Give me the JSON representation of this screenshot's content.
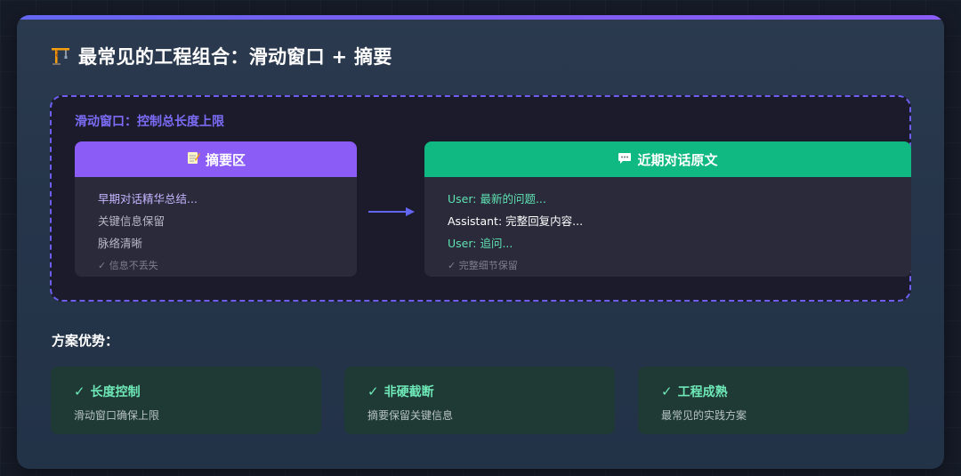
{
  "title": "最常见的工程组合：滑动窗口 + 摘要",
  "icons": {
    "title_icon": "building-construction-crane-icon",
    "summary_icon": "memo-icon",
    "recent_icon": "speech-bubble-icon",
    "arrow": "arrow-right-icon",
    "check": "check-mark-icon"
  },
  "window": {
    "label": "滑动窗口：控制总长度上限"
  },
  "summary_panel": {
    "title": "摘要区",
    "lines": [
      "早期对话精华总结...",
      "关键信息保留",
      "脉络清晰",
      "✓ 信息不丢失"
    ]
  },
  "recent_panel": {
    "title": "近期对话原文",
    "lines": [
      "User: 最新的问题...",
      "Assistant: 完整回复内容...",
      "User: 追问...",
      "✓ 完整细节保留"
    ]
  },
  "advantages": {
    "title": "方案优势：",
    "items": [
      {
        "title": "长度控制",
        "desc": "滑动窗口确保上限"
      },
      {
        "title": "非硬截断",
        "desc": "摘要保留关键信息"
      },
      {
        "title": "工程成熟",
        "desc": "最常见的实践方案"
      }
    ]
  },
  "colors": {
    "accent_purple": "#8b5cf6",
    "accent_green": "#10b981",
    "window_dash": "#6d5ef0",
    "advantage_bg": "#1f3a35"
  }
}
